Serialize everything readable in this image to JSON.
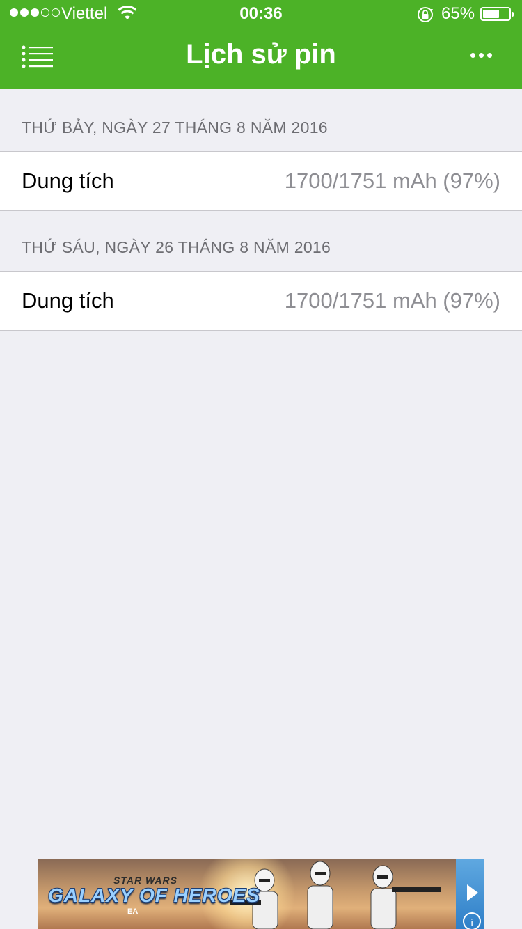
{
  "status_bar": {
    "carrier": "Viettel",
    "signal_bars_filled": 3,
    "signal_bars_total": 5,
    "time": "00:36",
    "battery_percent": "65%",
    "battery_level": 0.65,
    "icons": [
      "wifi-icon",
      "orientation-lock-icon",
      "battery-icon"
    ]
  },
  "nav": {
    "title": "Lịch sử pin",
    "left_icon": "menu-list-icon",
    "right_icon": "more-icon"
  },
  "sections": [
    {
      "header": "THỨ BẢY, NGÀY 27 THÁNG 8 NĂM 2016",
      "rows": [
        {
          "label": "Dung tích",
          "value": "1700/1751 mAh (97%)"
        }
      ]
    },
    {
      "header": "THỨ SÁU, NGÀY 26 THÁNG 8 NĂM 2016",
      "rows": [
        {
          "label": "Dung tích",
          "value": "1700/1751 mAh (97%)"
        }
      ]
    }
  ],
  "ad": {
    "brand_top": "STAR WARS",
    "brand": "GALAXY OF HEROES",
    "publisher": "EA",
    "icons": [
      "play-icon",
      "info-icon"
    ]
  },
  "colors": {
    "accent": "#4cb227",
    "background": "#efeff4",
    "secondary_text": "#8e8e93"
  }
}
